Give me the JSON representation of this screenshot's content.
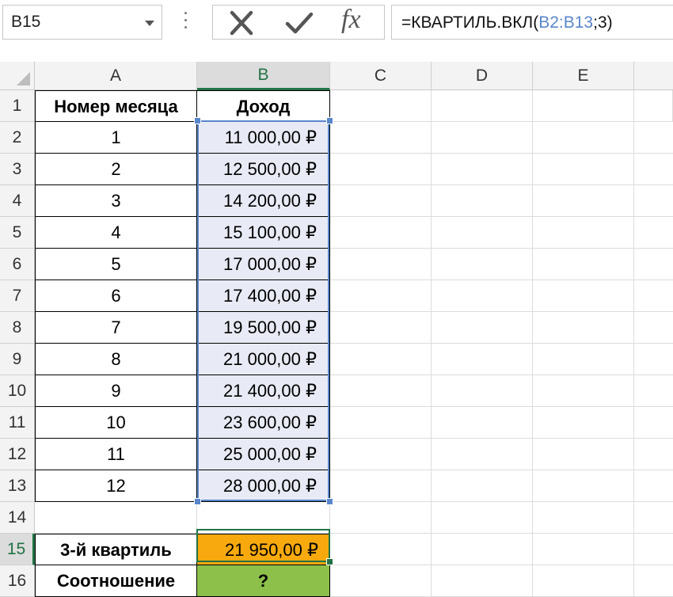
{
  "formula_bar": {
    "name_box": "B15",
    "formula_prefix": "=КВАРТИЛЬ.ВКЛ(",
    "formula_range": "B2:B13",
    "formula_suffix": ";3)",
    "cancel_icon": "x-icon",
    "enter_icon": "checkmark-icon",
    "function_icon": "fx-icon",
    "fx_label": "fx"
  },
  "columns": [
    "A",
    "B",
    "C",
    "D",
    "E"
  ],
  "rows": [
    "1",
    "2",
    "3",
    "4",
    "5",
    "6",
    "7",
    "8",
    "9",
    "10",
    "11",
    "12",
    "13",
    "14",
    "15",
    "16"
  ],
  "table": {
    "header_month": "Номер месяца",
    "header_income": "Доход",
    "months": [
      "1",
      "2",
      "3",
      "4",
      "5",
      "6",
      "7",
      "8",
      "9",
      "10",
      "11",
      "12"
    ],
    "incomes": [
      "11 000,00 ₽",
      "12 500,00 ₽",
      "14 200,00 ₽",
      "15 100,00 ₽",
      "17 000,00 ₽",
      "17 400,00 ₽",
      "19 500,00 ₽",
      "21 000,00 ₽",
      "21 400,00 ₽",
      "23 600,00 ₽",
      "25 000,00 ₽",
      "28 000,00 ₽"
    ],
    "quartile_label": "3-й квартиль",
    "quartile_value": "21 950,00 ₽",
    "ratio_label": "Соотношение",
    "ratio_value": "?"
  },
  "colors": {
    "selected_header": "#217346",
    "range_border": "#5a86cc",
    "orange_fill": "#f7a90e",
    "green_fill": "#8cc04a"
  }
}
